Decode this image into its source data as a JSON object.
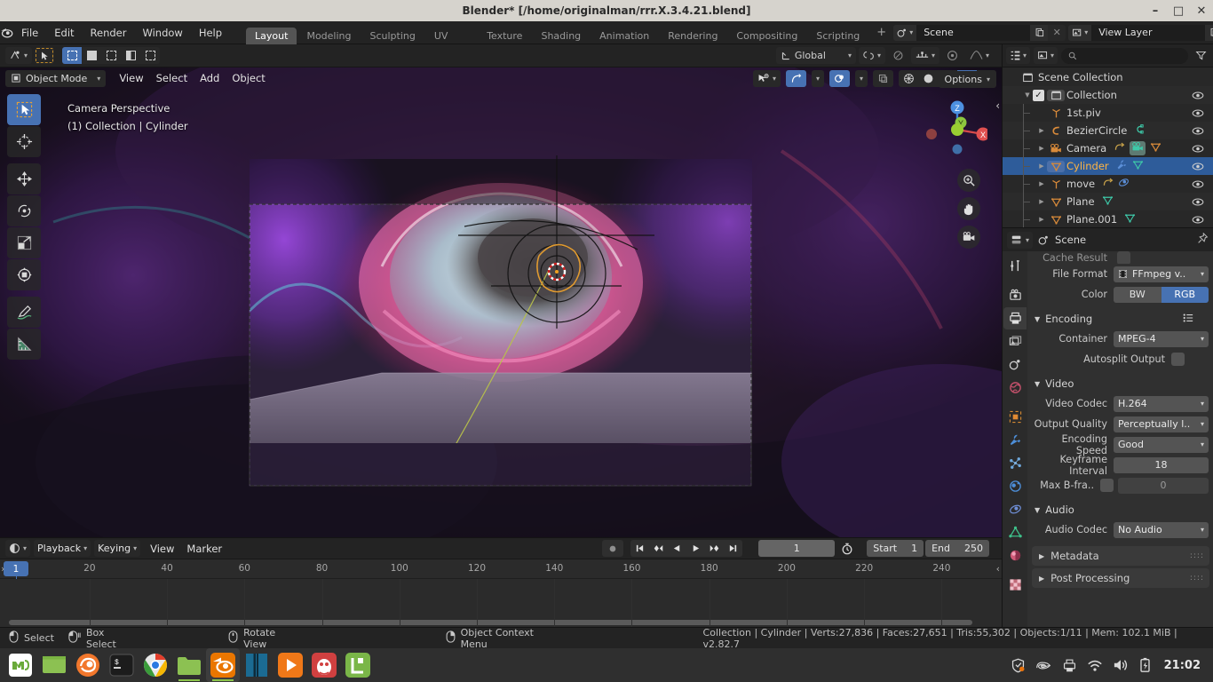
{
  "window": {
    "title": "Blender* [/home/originalman/rrr.X.3.4.21.blend]",
    "minimize": "–",
    "maximize": "□",
    "close": "✕"
  },
  "topbar": {
    "menus": [
      "File",
      "Edit",
      "Render",
      "Window",
      "Help"
    ],
    "workspaces": [
      {
        "label": "Layout",
        "active": true
      },
      {
        "label": "Modeling",
        "active": false
      },
      {
        "label": "Sculpting",
        "active": false
      },
      {
        "label": "UV Editing",
        "active": false
      },
      {
        "label": "Texture Paint",
        "active": false
      },
      {
        "label": "Shading",
        "active": false
      },
      {
        "label": "Animation",
        "active": false
      },
      {
        "label": "Rendering",
        "active": false
      },
      {
        "label": "Compositing",
        "active": false
      },
      {
        "label": "Scripting",
        "active": false
      }
    ],
    "add_workspace": "+",
    "scene_name": "Scene",
    "view_layer_name": "View Layer"
  },
  "viewport": {
    "transform_orientation": "Global",
    "options_label": "Options",
    "mode": "Object Mode",
    "menus": [
      "View",
      "Select",
      "Add",
      "Object"
    ],
    "overlay_line1": "Camera Perspective",
    "overlay_line2": "(1) Collection | Cylinder",
    "gizmo_axes": [
      "X",
      "Y",
      "Z"
    ]
  },
  "outliner": {
    "search_placeholder": "",
    "rows": [
      {
        "label": "Scene Collection",
        "icon": "collection-icon",
        "indent": 0,
        "selected": false,
        "expand": "",
        "checkbox": false,
        "eye": false,
        "extras": []
      },
      {
        "label": "Collection",
        "icon": "collection-icon",
        "indent": 1,
        "selected": false,
        "expand": "▼",
        "checkbox": true,
        "eye": true,
        "extras": []
      },
      {
        "label": "1st.piv",
        "icon": "empty-axes-icon",
        "indent": 2,
        "selected": false,
        "expand": "",
        "checkbox": false,
        "eye": true,
        "extras": []
      },
      {
        "label": "BezierCircle",
        "icon": "curve-icon",
        "indent": 2,
        "selected": false,
        "expand": "▶",
        "checkbox": false,
        "eye": true,
        "extras": [
          "curve-data-icon"
        ]
      },
      {
        "label": "Camera",
        "icon": "camera-icon",
        "indent": 2,
        "selected": false,
        "expand": "▶",
        "checkbox": false,
        "eye": true,
        "extras": [
          "constraint-icon",
          "camera-data-icon",
          "mesh-tri-icon"
        ]
      },
      {
        "label": "Cylinder",
        "icon": "mesh-tri-icon",
        "indent": 2,
        "selected": true,
        "expand": "▶",
        "checkbox": false,
        "eye": true,
        "extras": [
          "modifier-icon",
          "mesh-data-icon"
        ]
      },
      {
        "label": "move",
        "icon": "empty-axes-icon",
        "indent": 2,
        "selected": false,
        "expand": "▶",
        "checkbox": false,
        "eye": true,
        "extras": [
          "constraint-icon",
          "animation-icon"
        ]
      },
      {
        "label": "Plane",
        "icon": "mesh-tri-icon",
        "indent": 2,
        "selected": false,
        "expand": "▶",
        "checkbox": false,
        "eye": true,
        "extras": [
          "mesh-data-icon"
        ]
      },
      {
        "label": "Plane.001",
        "icon": "mesh-tri-icon",
        "indent": 2,
        "selected": false,
        "expand": "▶",
        "checkbox": false,
        "eye": true,
        "extras": [
          "mesh-data-icon"
        ]
      }
    ]
  },
  "properties": {
    "breadcrumb": "Scene",
    "clipped_row_label": "Cache Result",
    "file_format_label": "File Format",
    "file_format_value": "FFmpeg v..",
    "color_label": "Color",
    "color_bw": "BW",
    "color_rgb": "RGB",
    "color_selected": "RGB",
    "encoding_section": "Encoding",
    "container_label": "Container",
    "container_value": "MPEG-4",
    "autosplit_label": "Autosplit Output",
    "video_section": "Video",
    "video_codec_label": "Video Codec",
    "video_codec_value": "H.264",
    "output_quality_label": "Output Quality",
    "output_quality_value": "Perceptually l..",
    "encoding_speed_label": "Encoding Speed",
    "encoding_speed_value": "Good",
    "keyframe_interval_label": "Keyframe Interval",
    "keyframe_interval_value": "18",
    "max_bframes_label": "Max B-fra..",
    "max_bframes_value": "0",
    "audio_section": "Audio",
    "audio_codec_label": "Audio Codec",
    "audio_codec_value": "No Audio",
    "metadata_panel": "Metadata",
    "post_processing_panel": "Post Processing"
  },
  "timeline": {
    "menus": [
      "View",
      "Marker"
    ],
    "playback_label": "Playback",
    "keying_label": "Keying",
    "current_frame": "1",
    "start_label": "Start",
    "start_value": "1",
    "end_label": "End",
    "end_value": "250",
    "ticks": [
      {
        "label": "20",
        "frame": 20
      },
      {
        "label": "40",
        "frame": 40
      },
      {
        "label": "60",
        "frame": 60
      },
      {
        "label": "80",
        "frame": 80
      },
      {
        "label": "100",
        "frame": 100
      },
      {
        "label": "120",
        "frame": 120
      },
      {
        "label": "140",
        "frame": 140
      },
      {
        "label": "160",
        "frame": 160
      },
      {
        "label": "180",
        "frame": 180
      },
      {
        "label": "200",
        "frame": 200
      },
      {
        "label": "220",
        "frame": 220
      },
      {
        "label": "240",
        "frame": 240
      }
    ],
    "playhead_label": "1"
  },
  "statusbar": {
    "mouse_hints": [
      {
        "label": "Select",
        "icon": "mouse-left-icon"
      },
      {
        "label": "Box Select",
        "icon": "mouse-left-drag-icon"
      },
      {
        "label": "Rotate View",
        "icon": "mouse-middle-icon"
      },
      {
        "label": "Object Context Menu",
        "icon": "mouse-right-icon"
      }
    ],
    "scene_stats": "Collection | Cylinder | Verts:27,836 | Faces:27,651 | Tris:55,302 | Objects:1/11 | Mem: 102.1 MiB | v2.82.7"
  },
  "taskbar": {
    "apps": [
      {
        "name": "mint-menu",
        "color": "#ffffff",
        "glyph": "Ⓜ",
        "running": false,
        "active": false
      },
      {
        "name": "show-desktop",
        "color": "#8cc152",
        "glyph": "",
        "running": false,
        "active": false
      },
      {
        "name": "firefox",
        "color": "#f2772c",
        "glyph": "",
        "running": false,
        "active": false
      },
      {
        "name": "terminal",
        "color": "#1c1c1c",
        "glyph": "$_",
        "running": false,
        "active": false
      },
      {
        "name": "chrome",
        "color": "#ffffff",
        "glyph": "",
        "running": false,
        "active": false
      },
      {
        "name": "files",
        "color": "#8cc152",
        "glyph": "",
        "running": true,
        "active": false
      },
      {
        "name": "blender",
        "color": "#ea7600",
        "glyph": "",
        "running": true,
        "active": true
      },
      {
        "name": "vscode",
        "color": "#1b6b93",
        "glyph": "",
        "running": false,
        "active": false
      },
      {
        "name": "video-player",
        "color": "#f07818",
        "glyph": "▶",
        "running": false,
        "active": false
      },
      {
        "name": "gimp",
        "color": "#d44",
        "glyph": "",
        "running": false,
        "active": false
      },
      {
        "name": "libreoffice",
        "color": "#7ab648",
        "glyph": "",
        "running": false,
        "active": false
      }
    ],
    "tray_icons": [
      "shield-icon",
      "nvidia-icon",
      "printer-icon",
      "wifi-icon",
      "volume-icon",
      "battery-icon"
    ],
    "clock": "21:02"
  }
}
